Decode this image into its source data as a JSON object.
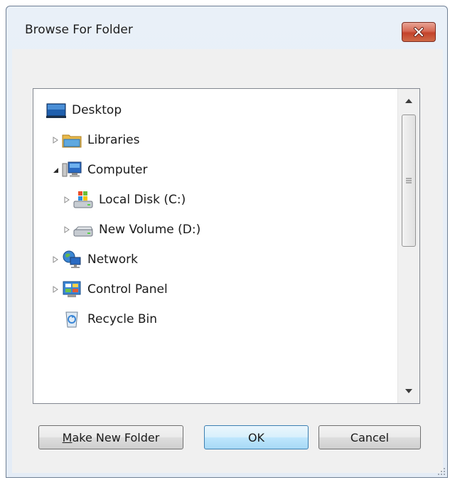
{
  "window": {
    "title": "Browse For Folder"
  },
  "tree": {
    "items": [
      {
        "label": "Desktop",
        "icon": "desktop-icon",
        "expander": "none"
      },
      {
        "label": "Libraries",
        "icon": "libraries-icon",
        "expander": "collapsed"
      },
      {
        "label": "Computer",
        "icon": "computer-icon",
        "expander": "expanded"
      },
      {
        "label": "Local Disk (C:)",
        "icon": "local-disk-icon",
        "expander": "collapsed"
      },
      {
        "label": "New Volume (D:)",
        "icon": "drive-icon",
        "expander": "collapsed"
      },
      {
        "label": "Network",
        "icon": "network-icon",
        "expander": "collapsed"
      },
      {
        "label": "Control Panel",
        "icon": "control-panel-icon",
        "expander": "collapsed"
      },
      {
        "label": "Recycle Bin",
        "icon": "recycle-bin-icon",
        "expander": "none"
      }
    ]
  },
  "buttons": {
    "make_new_folder_mnemonic": "M",
    "make_new_folder_rest": "ake New Folder",
    "ok": "OK",
    "cancel": "Cancel"
  },
  "colors": {
    "selection_default_border": "#3c7fb1",
    "close_red": "#c4432b"
  }
}
